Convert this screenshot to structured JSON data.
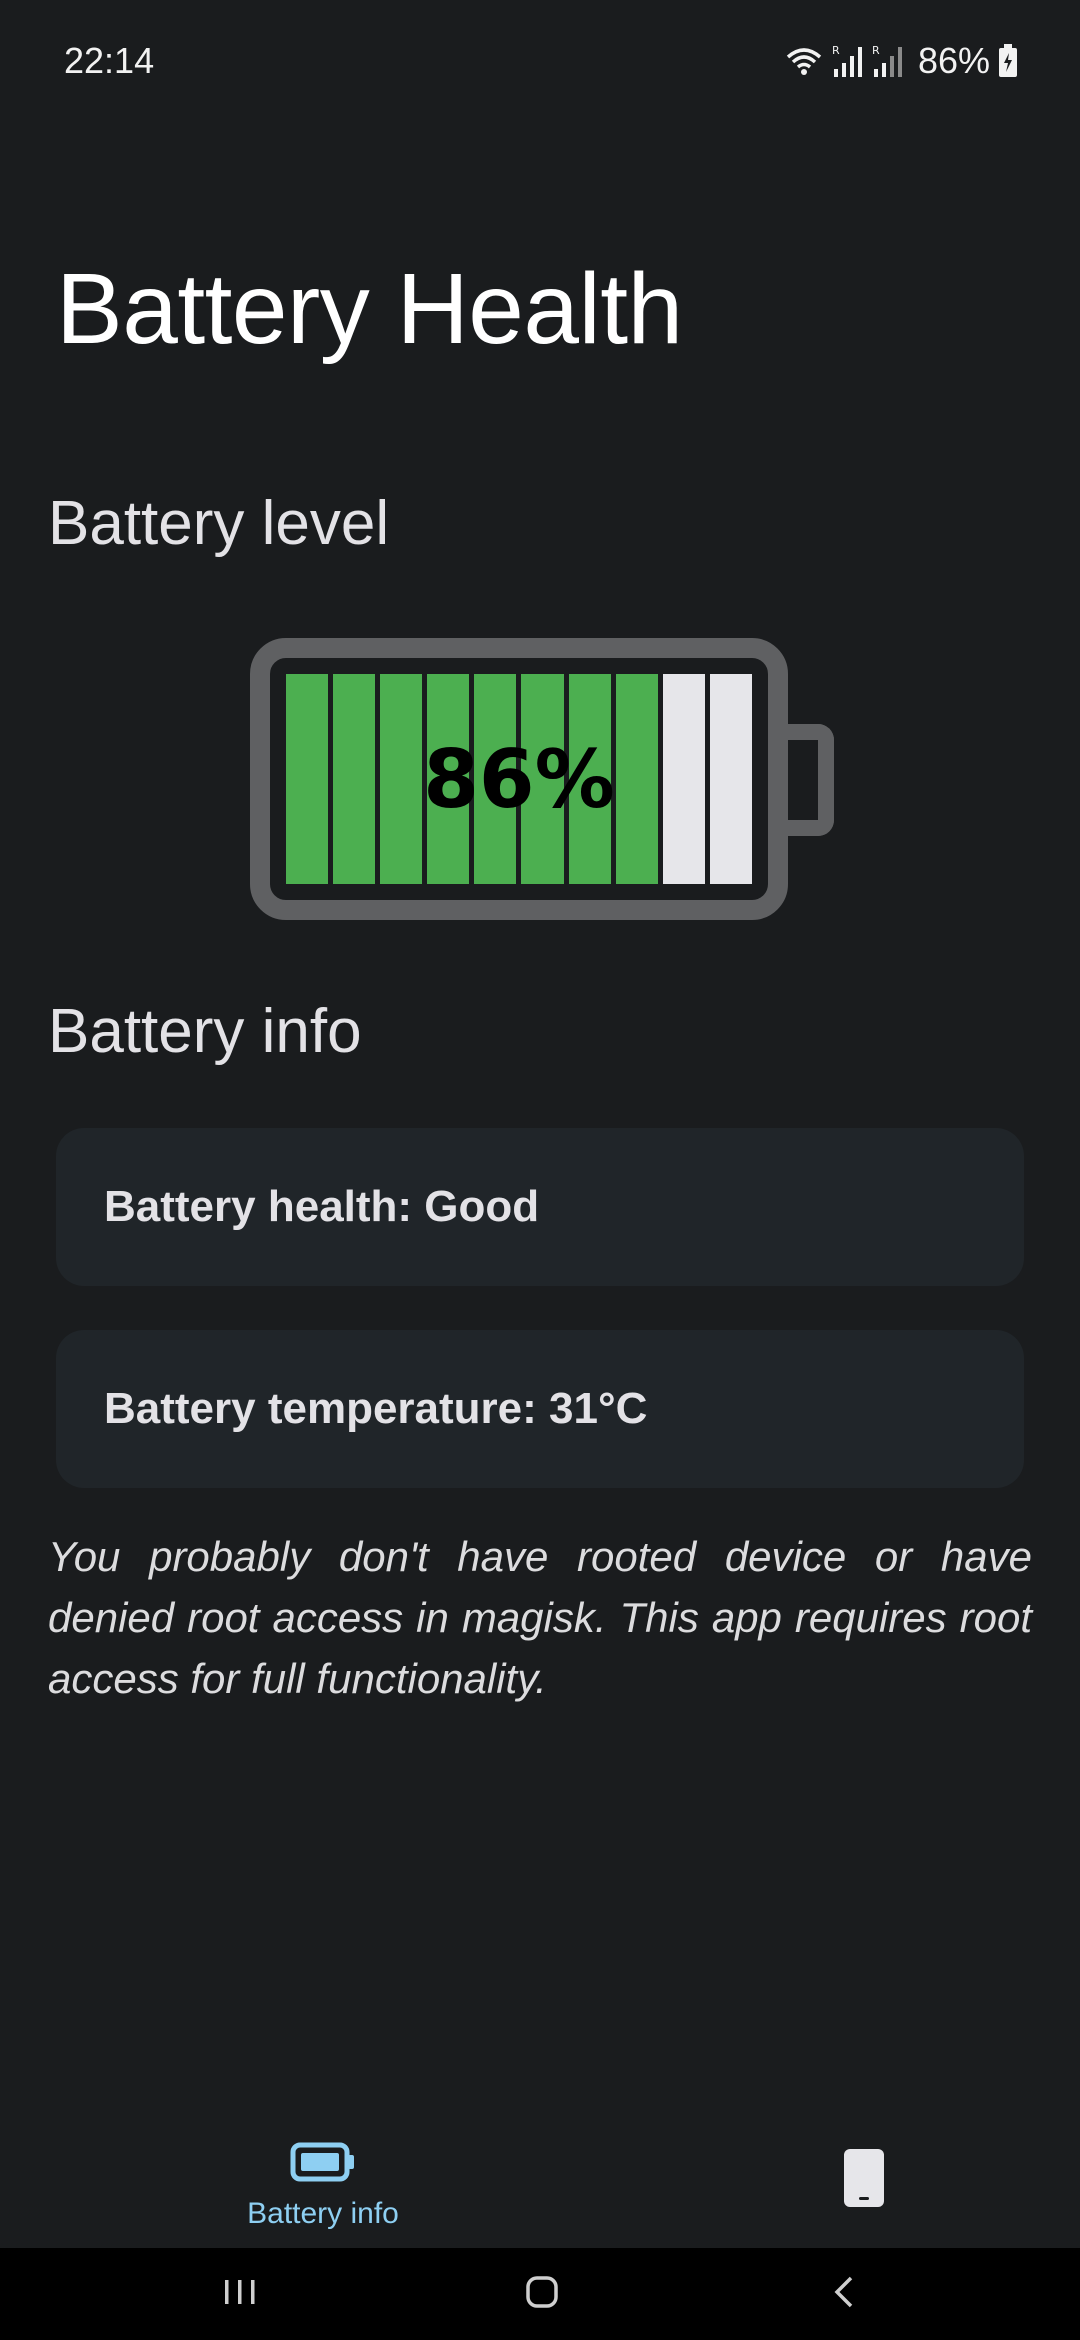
{
  "status_bar": {
    "time": "22:14",
    "battery_percent": "86%"
  },
  "page_title": "Battery Health",
  "battery_level": {
    "section_title": "Battery level",
    "percent_label": "86%",
    "level": 86,
    "cells_total": 10,
    "cells_filled": 8,
    "fill_color": "#4caf50",
    "empty_color": "#e6e6ea"
  },
  "battery_info": {
    "section_title": "Battery info",
    "health": "Battery health: Good",
    "temperature": "Battery temperature: 31°C"
  },
  "root_note": "You probably don't have rooted device or have denied root access in magisk. This app requires root access for full functionality.",
  "bottom_nav": {
    "items": [
      {
        "label": "Battery info",
        "icon": "battery-icon",
        "active": true
      },
      {
        "label": "",
        "icon": "phone-icon",
        "active": false
      }
    ],
    "active_color": "#8ecff2"
  },
  "system_nav": {
    "buttons": [
      "recents-icon",
      "home-icon",
      "back-icon"
    ]
  }
}
